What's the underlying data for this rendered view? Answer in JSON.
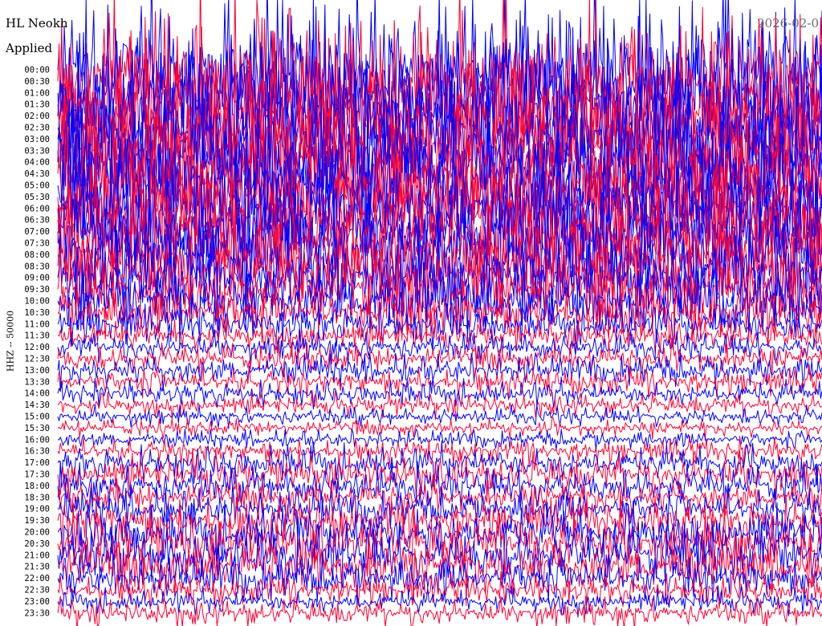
{
  "header": {
    "station_title": "HL Neokh",
    "date_text": "2026-02-0",
    "filter_text": "Applied",
    "channel_label": "HHZ -- 50000"
  },
  "colors": {
    "trace_a": "#0000ff",
    "trace_b": "#ff0033",
    "background": "#ffffff"
  },
  "chart_data": {
    "type": "line",
    "title": "HL Neokh",
    "subtitle": "Applied",
    "ylabel": "HHZ -- 50000",
    "tick_labels": [
      "00:00",
      "00:30",
      "01:00",
      "01:30",
      "02:00",
      "02:30",
      "03:00",
      "03:30",
      "04:00",
      "04:30",
      "05:00",
      "05:30",
      "06:00",
      "06:30",
      "07:00",
      "07:30",
      "08:00",
      "08:30",
      "09:00",
      "09:30",
      "10:00",
      "10:30",
      "11:00",
      "11:30",
      "12:00",
      "12:30",
      "13:00",
      "13:30",
      "14:00",
      "14:30",
      "15:00",
      "15:30",
      "16:00",
      "16:30",
      "17:00",
      "17:30",
      "18:00",
      "18:30",
      "19:00",
      "19:30",
      "20:00",
      "20:30",
      "21:00",
      "21:30",
      "22:00",
      "22:30",
      "23:00",
      "23:30"
    ],
    "trace_colors": [
      "#0000ff",
      "#ff0033"
    ],
    "relative_amplitude": [
      9.0,
      9.0,
      9.0,
      8.8,
      8.8,
      8.6,
      8.5,
      8.5,
      8.4,
      8.2,
      8.0,
      7.8,
      7.6,
      7.4,
      7.2,
      7.0,
      6.8,
      6.4,
      5.8,
      5.0,
      4.0,
      3.2,
      2.4,
      1.9,
      1.7,
      1.7,
      1.8,
      1.7,
      1.5,
      1.3,
      1.1,
      1.0,
      1.1,
      1.5,
      2.0,
      2.3,
      2.3,
      2.0,
      2.3,
      2.8,
      3.2,
      3.6,
      3.6,
      3.3,
      2.6,
      1.8,
      1.4,
      1.6
    ],
    "grid": false,
    "legend": "none"
  }
}
